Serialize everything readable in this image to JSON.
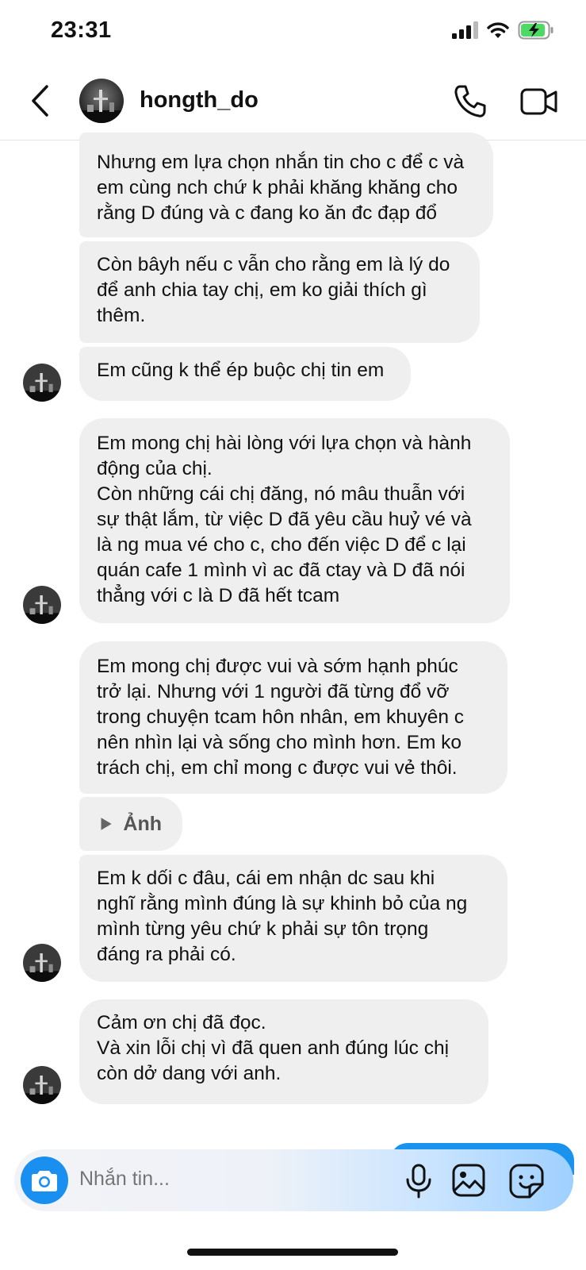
{
  "status_bar": {
    "time": "23:31",
    "icons": [
      "signal-icon",
      "wifi-icon",
      "battery-charging-icon"
    ],
    "battery_color": "#4cd964"
  },
  "header": {
    "contact_name": "hongth_do",
    "icons": [
      "back-arrow-icon",
      "phone-icon",
      "video-camera-icon"
    ]
  },
  "messages": [
    {
      "text": "Nhưng em lựa chọn nhắn tin cho c để c và\nem cùng nch chứ k phải khăng khăng cho\nrằng D đúng và c đang ko ăn đc đạp đổ"
    },
    {
      "text": "Còn bâyh nếu c vẫn cho rằng em là lý do\nđể anh chia tay chị, em ko giải thích gì\nthêm."
    },
    {
      "text": "Em cũng k thể ép buộc chị tin em"
    },
    {
      "text": "Em mong chị hài lòng với lựa chọn và hành\nđộng của chị.\nCòn những cái chị đăng, nó mâu thuẫn với\nsự thật lắm, từ việc D đã yêu cầu huỷ vé và\nlà ng mua vé cho c, cho đến việc D để c lại\nquán cafe 1 mình vì ac đã ctay và D đã nói\nthẳng với c là D đã hết tcam"
    },
    {
      "text": "Em mong chị được vui và sớm hạnh phúc\ntrở lại. Nhưng với 1 người đã từng đổ vỡ\ntrong chuyện tcam hôn nhân, em khuyên c\nnên nhìn lại và sống cho mình hơn. Em ko\ntrách chị, em chỉ mong c được vui vẻ thôi."
    },
    {
      "media_label": "Ảnh",
      "icon": "play-icon"
    },
    {
      "text": "Em k dối c đâu, cái em nhận dc sau khi\nnghĩ rằng mình đúng là sự khinh bỏ của ng\nmình từng yêu chứ k phải sự tôn trọng\nđáng ra phải có."
    },
    {
      "text": "Cảm ơn chị đã đọc.\nVà xin lỗi chị vì đã quen anh đúng lúc chị\ncòn dở dang với anh."
    }
  ],
  "composer": {
    "placeholder": "Nhắn tin...",
    "icons": [
      "camera-icon",
      "microphone-icon",
      "gallery-icon",
      "sticker-icon"
    ],
    "accent_color": "#1990f0"
  }
}
